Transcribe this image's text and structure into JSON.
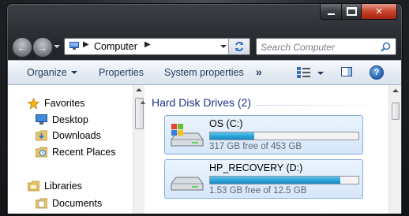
{
  "window": {
    "caption_buttons": [
      "minimize",
      "maximize",
      "close"
    ]
  },
  "navigation": {
    "address_crumb": "Computer",
    "search_placeholder": "Search Computer"
  },
  "toolbar": {
    "organize_label": "Organize",
    "properties_label": "Properties",
    "system_properties_label": "System properties",
    "more_label": "»"
  },
  "sidebar": {
    "favorites_label": "Favorites",
    "items": [
      {
        "label": "Desktop",
        "icon": "desktop-icon"
      },
      {
        "label": "Downloads",
        "icon": "downloads-folder-icon"
      },
      {
        "label": "Recent Places",
        "icon": "recent-places-icon"
      }
    ],
    "libraries_label": "Libraries",
    "documents_label": "Documents"
  },
  "main": {
    "group_header": "Hard Disk Drives (2)",
    "drives": [
      {
        "name": "OS (C:)",
        "free_text": "317 GB free of 453 GB",
        "used_fraction": 0.3,
        "icon": "windows-drive-icon"
      },
      {
        "name": "HP_RECOVERY (D:)",
        "free_text": "1.53 GB free of 12.5 GB",
        "used_fraction": 0.88,
        "icon": "hard-drive-icon"
      }
    ]
  },
  "colors": {
    "accent_header": "#1e3287",
    "usage_bar": "#2aa2d8",
    "selection_border": "#84acdd"
  }
}
